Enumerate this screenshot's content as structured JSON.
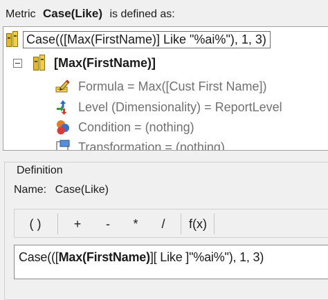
{
  "header": {
    "prefix": "Metric",
    "metric_name": "Case(Like)",
    "suffix": "is defined as:"
  },
  "tree": {
    "root_label": "Case(([Max(FirstName)] Like \"%ai%\"), 1, 3)",
    "child_label": "[Max(FirstName)]",
    "properties": [
      {
        "label": "Formula = Max([Cust First Name])",
        "icon": "formula-pencil-icon"
      },
      {
        "label": "Level (Dimensionality) = ReportLevel",
        "icon": "level-arrows-icon"
      },
      {
        "label": "Condition = (nothing)",
        "icon": "condition-shapes-icon"
      },
      {
        "label": "Transformation = (nothing)",
        "icon": "transformation-icon"
      }
    ]
  },
  "definition": {
    "group_title": "Definition",
    "name_label": "Name:",
    "name_value": "Case(Like)",
    "toolbar": {
      "parens": "( )",
      "plus": "+",
      "minus": "-",
      "multiply": "*",
      "divide": "/",
      "function": "f(x)"
    },
    "expression": {
      "part1": "Case(([",
      "part2": "Max(FirstName)",
      "part3": "][ Like ]\"%ai%\"), 1, 3)"
    }
  },
  "colors": {
    "window_bg": "#f0f0f0",
    "tree_bg": "#ffffff",
    "metric_icon_gold": "#e2b92a",
    "disabled_text": "#707070"
  }
}
